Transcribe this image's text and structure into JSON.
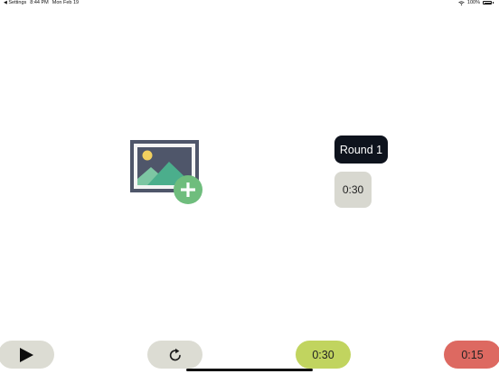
{
  "status_bar": {
    "back_label": "Settings",
    "time": "8:44 PM",
    "date": "Mon Feb 19",
    "battery": "100%"
  },
  "image_placeholder": {
    "icon": "add-photo-icon"
  },
  "round": {
    "label": "Round 1",
    "duration": "0:30"
  },
  "controls": {
    "play_icon": "play-icon",
    "reset_icon": "reset-icon",
    "work_time": "0:30",
    "rest_time": "0:15"
  },
  "colors": {
    "round_chip": "#0e131d",
    "neutral_button": "#dcdcd3",
    "work_button": "#c1d45f",
    "rest_button": "#dd6961",
    "add_badge": "#6fbd7d"
  }
}
